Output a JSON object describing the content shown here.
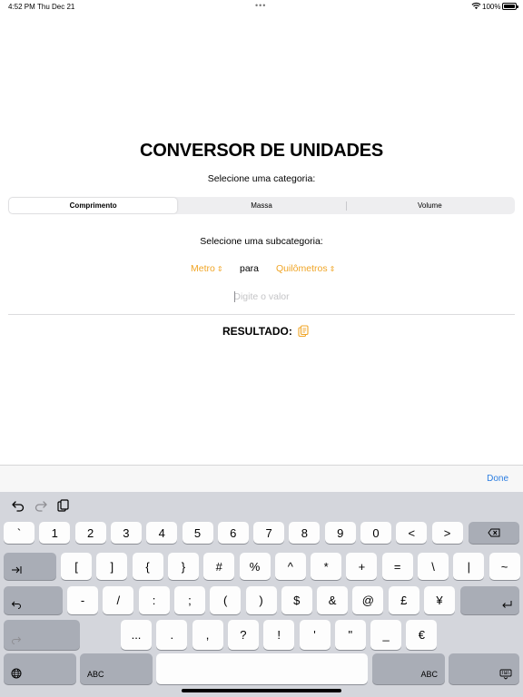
{
  "status_bar": {
    "time": "4:52 PM",
    "date": "Thu Dec 21",
    "multitask": "•••",
    "wifi_icon": "wifi-icon",
    "battery_percent": "100%",
    "battery_level": 1.0
  },
  "main": {
    "title": "CONVERSOR DE UNIDADES",
    "category_label": "Selecione uma categoria:",
    "categories": [
      {
        "label": "Comprimento",
        "selected": true
      },
      {
        "label": "Massa",
        "selected": false
      },
      {
        "label": "Volume",
        "selected": false
      }
    ],
    "subcategory_label": "Selecione uma subcategoria:",
    "from_unit": "Metro",
    "to_word": "para",
    "to_unit": "Quilômetros",
    "input": {
      "value": "",
      "placeholder": "Digite o valor"
    },
    "result_label": "RESULTADO:",
    "copy_icon": "clipboard-copy-icon"
  },
  "colors": {
    "accent": "#f0a526",
    "link": "#2b7de1"
  },
  "keyboard": {
    "done_label": "Done",
    "assistant_icons": [
      "undo-icon",
      "redo-icon",
      "paste-icon"
    ],
    "row1": [
      "`",
      "1",
      "2",
      "3",
      "4",
      "5",
      "6",
      "7",
      "8",
      "9",
      "0",
      "<",
      ">"
    ],
    "row2": [
      "[",
      "]",
      "{",
      "}",
      "#",
      "%",
      "^",
      "*",
      "+",
      "=",
      "\\",
      "|",
      "~"
    ],
    "row3": [
      "-",
      "/",
      ":",
      ";",
      "(",
      ")",
      "$",
      "&",
      "@",
      "£",
      "¥"
    ],
    "row4": [
      "...",
      ".",
      ",",
      "?",
      "!",
      "'",
      "\"",
      "_",
      "€"
    ],
    "abc_left": "ABC",
    "abc_right": "ABC"
  }
}
